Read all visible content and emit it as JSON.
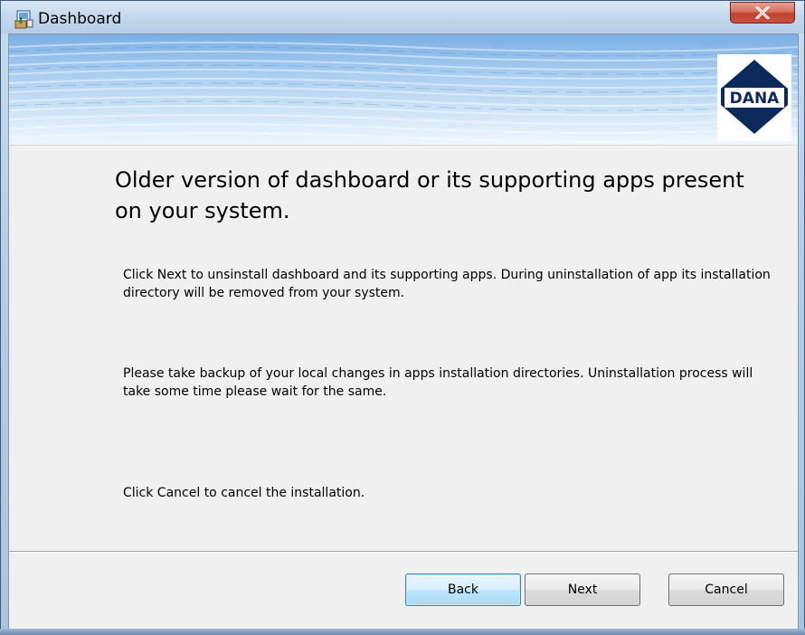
{
  "window": {
    "title": "Dashboard",
    "app_icon": "installer-icon",
    "close_icon": "close-icon"
  },
  "banner": {
    "logo_text": "DANA",
    "logo_icon": "dana-logo"
  },
  "content": {
    "heading": "Older version of dashboard or its supporting apps present on your system.",
    "paragraph1": "Click Next to unsinstall dashboard and its supporting apps. During uninstallation of app its installation directory will be removed from your system.",
    "paragraph2": "Please take backup of your local changes in apps installation directories. Uninstallation process will take some time please wait for the same.",
    "paragraph3": "Click Cancel to cancel the installation."
  },
  "buttons": {
    "back": "Back",
    "next": "Next",
    "cancel": "Cancel"
  },
  "colors": {
    "close_button": "#c9533e",
    "focused_button_border": "#3c7fb1",
    "dialog_background": "#f0f0f0"
  }
}
